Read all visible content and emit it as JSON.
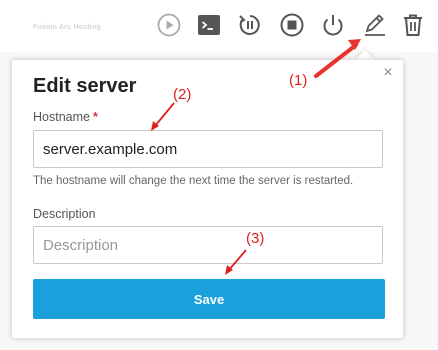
{
  "header": {
    "brand": "Fusion Arc Hosting",
    "icons": [
      {
        "name": "play-icon",
        "label": "Start"
      },
      {
        "name": "console-icon",
        "label": "Console"
      },
      {
        "name": "rebuild-icon",
        "label": "Rebuild"
      },
      {
        "name": "stop-icon",
        "label": "Stop"
      },
      {
        "name": "power-icon",
        "label": "Power"
      },
      {
        "name": "edit-pencil-icon",
        "label": "Edit"
      },
      {
        "name": "trash-icon",
        "label": "Delete"
      }
    ]
  },
  "dialog": {
    "title": "Edit server",
    "close_glyph": "×",
    "hostname": {
      "label": "Hostname",
      "required_mark": "*",
      "value": "server.example.com",
      "help": "The hostname will change the next time the server is restarted."
    },
    "description": {
      "label": "Description",
      "placeholder": "Description",
      "value": ""
    },
    "save_label": "Save"
  },
  "annotations": {
    "step1": "(1)",
    "step2": "(2)",
    "step3": "(3)"
  },
  "colors": {
    "accent": "#1aa1dc",
    "annotation": "#e02020",
    "required": "#d9363e",
    "icon": "#555555",
    "icon_light": "#aaaaaa"
  }
}
